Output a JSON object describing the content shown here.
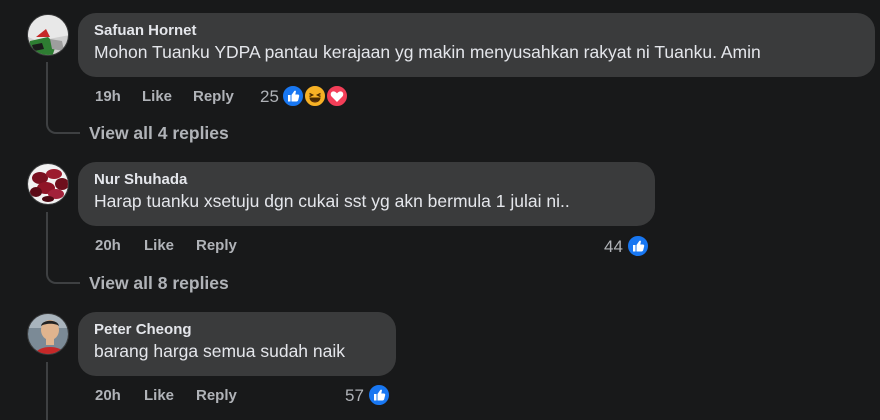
{
  "comments": [
    {
      "author": "Safuan Hornet",
      "text": "Mohon Tuanku YDPA pantau kerajaan yg makin menyusahkan rakyat ni Tuanku. Amin",
      "time": "19h",
      "like_label": "Like",
      "reply_label": "Reply",
      "reaction_count": "25",
      "reactions": [
        "like-icon",
        "haha-icon",
        "love-icon"
      ],
      "view_replies": "View all 4 replies"
    },
    {
      "author": "Nur Shuhada",
      "text": "Harap tuanku xsetuju dgn cukai sst yg akn bermula 1 julai ni..",
      "time": "20h",
      "like_label": "Like",
      "reply_label": "Reply",
      "reaction_count": "44",
      "reactions": [
        "like-icon"
      ],
      "view_replies": "View all 8 replies"
    },
    {
      "author": "Peter Cheong",
      "text": "barang harga semua sudah naik",
      "time": "20h",
      "like_label": "Like",
      "reply_label": "Reply",
      "reaction_count": "57",
      "reactions": [
        "like-icon"
      ]
    }
  ],
  "colors": {
    "background": "#18191a",
    "bubble": "#3a3b3c",
    "text_primary": "#e4e6eb",
    "text_secondary": "#b0b3b8",
    "like_blue": "#1877f2",
    "love_red": "#f33e58",
    "haha_yellow": "#f7b125"
  }
}
